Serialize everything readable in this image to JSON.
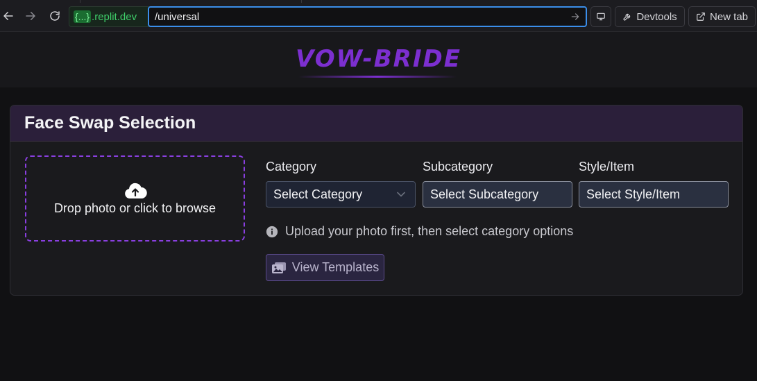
{
  "browser": {
    "url_prefix_badge": "{...}",
    "url_domain": ".replit.dev",
    "url_path": "/universal",
    "devtools_label": "Devtools",
    "new_tab_label": "New tab"
  },
  "header": {
    "brand": "VOW-BRIDE",
    "brand_color": "#7c2fd0"
  },
  "card": {
    "title": "Face Swap Selection",
    "dropzone_text": "Drop photo or click to browse",
    "fields": {
      "category": {
        "label": "Category",
        "value": "Select Category"
      },
      "subcategory": {
        "label": "Subcategory",
        "value": "Select Subcategory"
      },
      "style": {
        "label": "Style/Item",
        "value": "Select Style/Item"
      }
    },
    "hint": "Upload your photo first, then select category options",
    "view_templates_label": "View Templates"
  },
  "icons": [
    "back-arrow-icon",
    "forward-arrow-icon",
    "reload-icon",
    "url-go-arrow-icon",
    "monitor-icon",
    "wrench-icon",
    "external-link-icon",
    "cloud-upload-icon",
    "info-icon",
    "images-icon",
    "chevron-down-icon"
  ]
}
